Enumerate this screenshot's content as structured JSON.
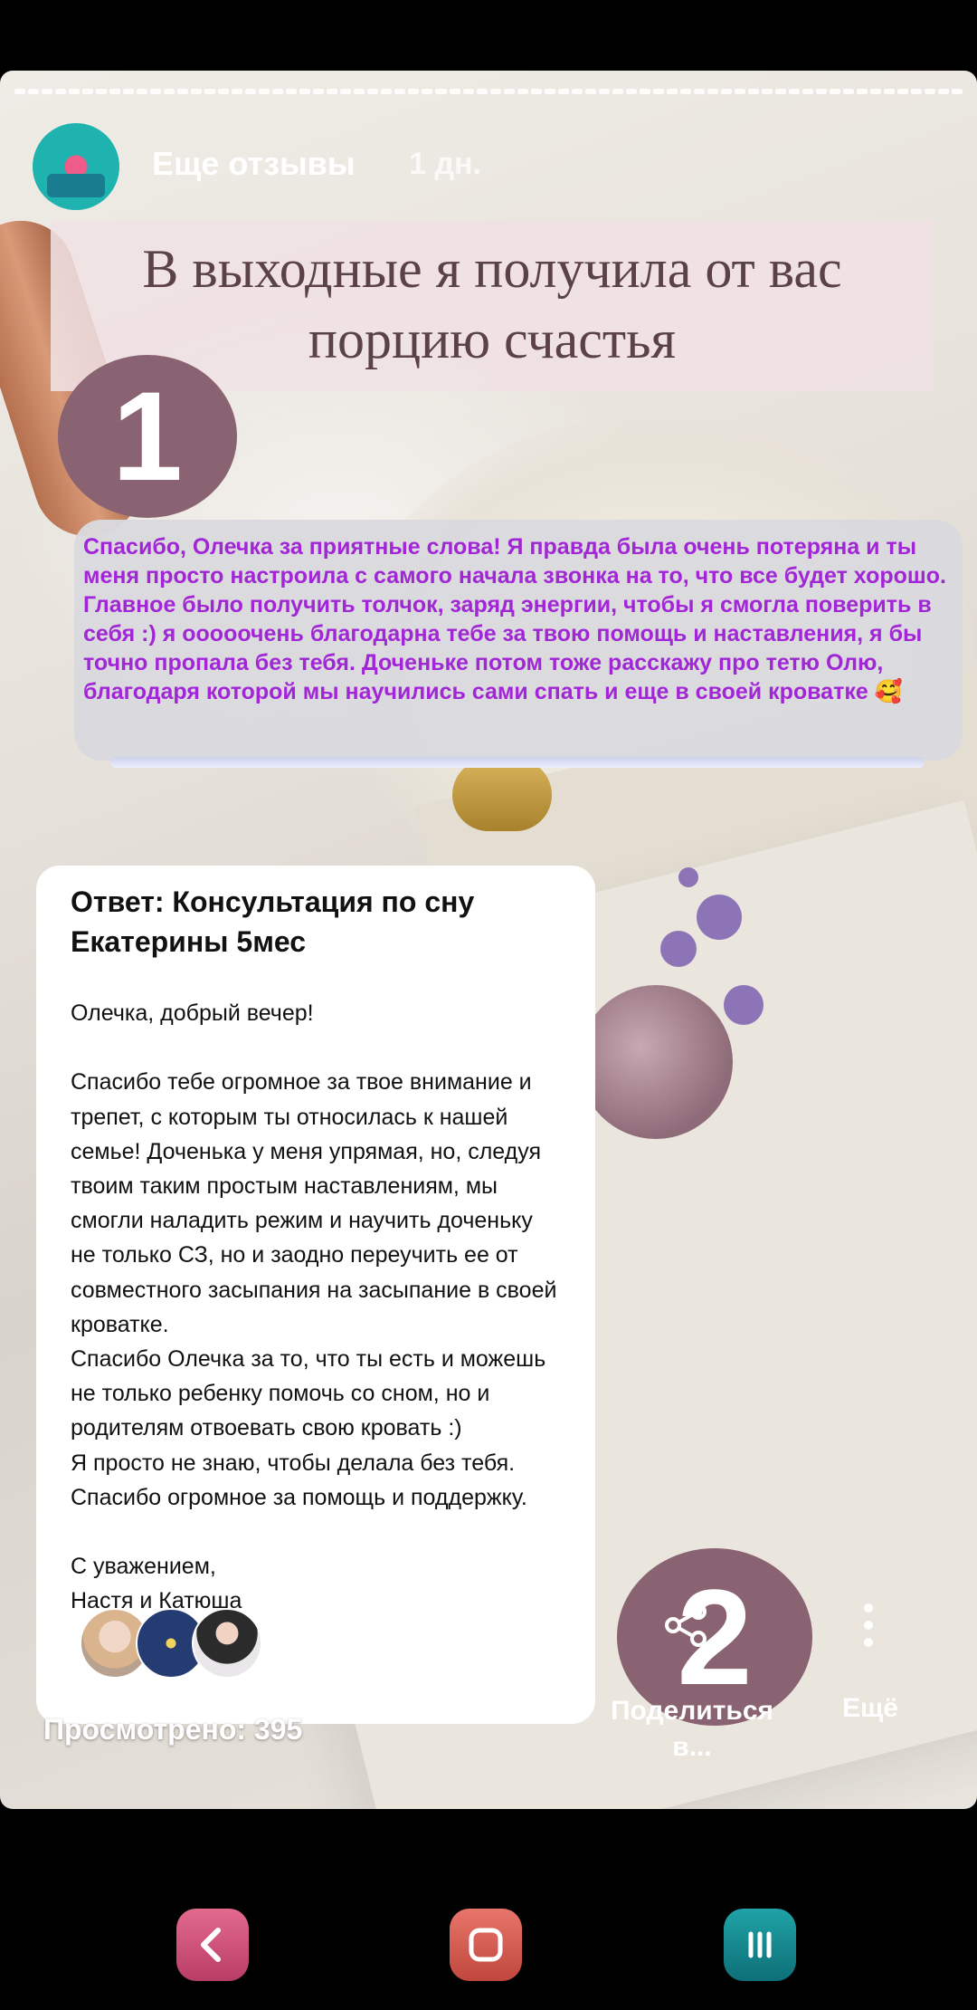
{
  "header": {
    "author": "Еще отзывы",
    "time": "1 дн."
  },
  "title": "В выходные я получила от вас порцию счастья",
  "badges": {
    "first": "1",
    "second": "2"
  },
  "quote": {
    "text": "Спасибо, Олечка за приятные слова! Я правда была очень потеряна и ты меня просто настроила с самого начала звонка на то, что все будет хорошо. Главное было получить толчок, заряд энергии, чтобы я смогла поверить в себя :) я ооооочень благодарна тебе за твою помощь и наставления, я бы точно пропала без тебя. Доченьке потом тоже расскажу про тетю Олю, благодаря которой мы научились сами спать и еще в своей кроватке 🥰"
  },
  "email": {
    "subject": "Ответ: Консультация по сну Екатерины 5мес",
    "body": "Олечка, добрый вечер!\n\nСпасибо тебе огромное за твое внимание и трепет, с которым ты относилась к нашей семье! Доченька у меня упрямая, но, следуя твоим таким простым наставлениям, мы смогли наладить режим и научить доченьку не только СЗ, но и заодно переучить ее от совместного засыпания на засыпание в своей кроватке.\nСпасибо Олечка за то, что ты есть и можешь не только ребенку помочь со сном, но и родителям отвоевать свою кровать :)\nЯ просто не знаю, чтобы делала без тебя. Спасибо огромное за помощь и поддержку.\n\nС уважением,\nНастя и Катюша"
  },
  "footer": {
    "viewed": "Просмотрено: 395",
    "share_label": "Поделиться в...",
    "more_label": "Ещё"
  },
  "icons": {
    "share": "share-icon",
    "more": "more-vertical-icon",
    "back": "back-chevron-icon",
    "home": "home-square-icon",
    "recent": "recent-apps-icon"
  },
  "colors": {
    "badge": "#8a6372",
    "quote_text": "#a127d6",
    "title_text": "#5b4247"
  }
}
